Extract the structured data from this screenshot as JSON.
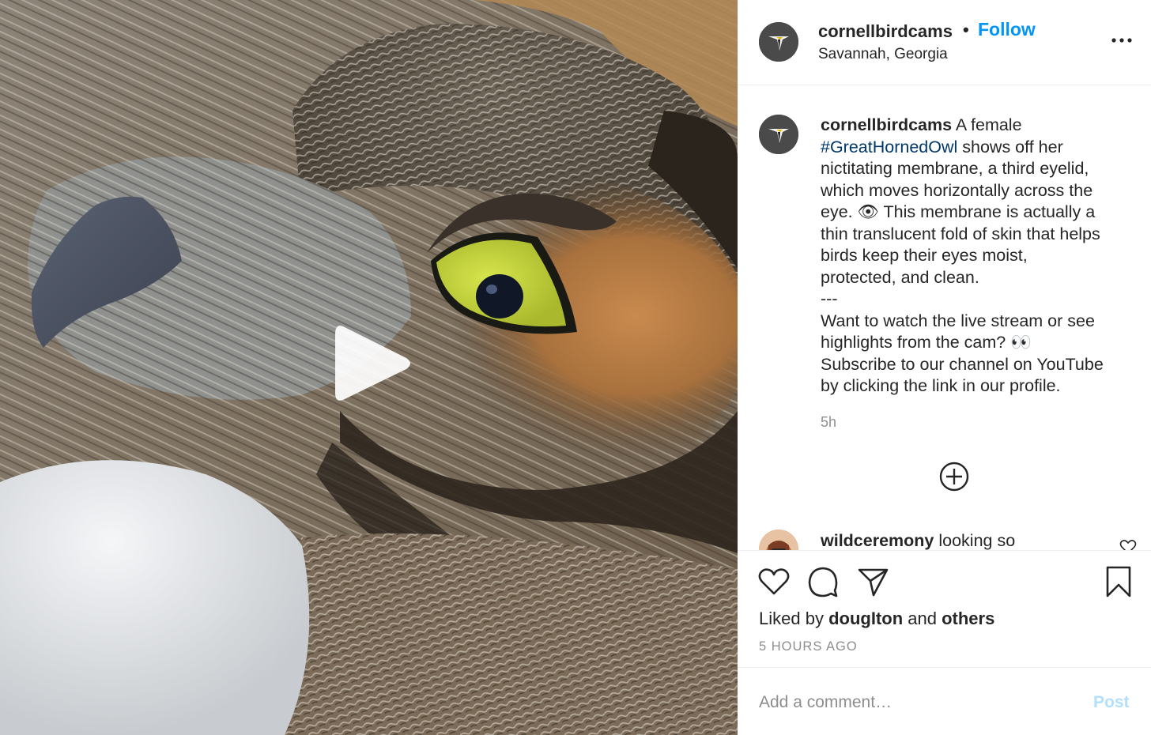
{
  "media": {
    "type": "video",
    "play_icon": "play-icon",
    "subject": "great-horned-owl-eye-closeup"
  },
  "header": {
    "username": "cornellbirdcams",
    "separator": "•",
    "follow_label": "Follow",
    "location": "Savannah, Georgia",
    "more_icon": "more-options-icon"
  },
  "caption": {
    "username": "cornellbirdcams",
    "text_before_tag": " A female\n",
    "hashtag": "#GreatHornedOwl",
    "text_after_tag": " shows off her\nnictitating membrane, a third eyelid,\nwhich moves horizontally across the\neye. 👁 This membrane is actually a\nthin translucent fold of skin that helps\nbirds keep their eyes moist,\nprotected, and clean.\n---\nWant to watch the live stream or see\nhighlights from the cam? 👀\nSubscribe to our channel on YouTube\nby clicking the link in our profile.",
    "time": "5h"
  },
  "load_more_icon": "plus-circle-icon",
  "comments": [
    {
      "username": "wildceremony",
      "text": " looking so"
    }
  ],
  "actions": {
    "like_icon": "heart-icon",
    "comment_icon": "comment-bubble-icon",
    "share_icon": "paper-plane-icon",
    "save_icon": "bookmark-icon"
  },
  "likes": {
    "prefix": "Liked by ",
    "user": "dougIton",
    "connector": " and ",
    "others": "others"
  },
  "post_time": "5 HOURS AGO",
  "add_comment": {
    "placeholder": "Add a comment…",
    "post_label": "Post"
  },
  "colors": {
    "follow_blue": "#0095f6",
    "hashtag_blue": "#00376b",
    "post_disabled": "#b2dffc",
    "muted_gray": "#8e8e8e",
    "divider": "#efefef",
    "owl_eye_yellow": "#c9d93a"
  }
}
